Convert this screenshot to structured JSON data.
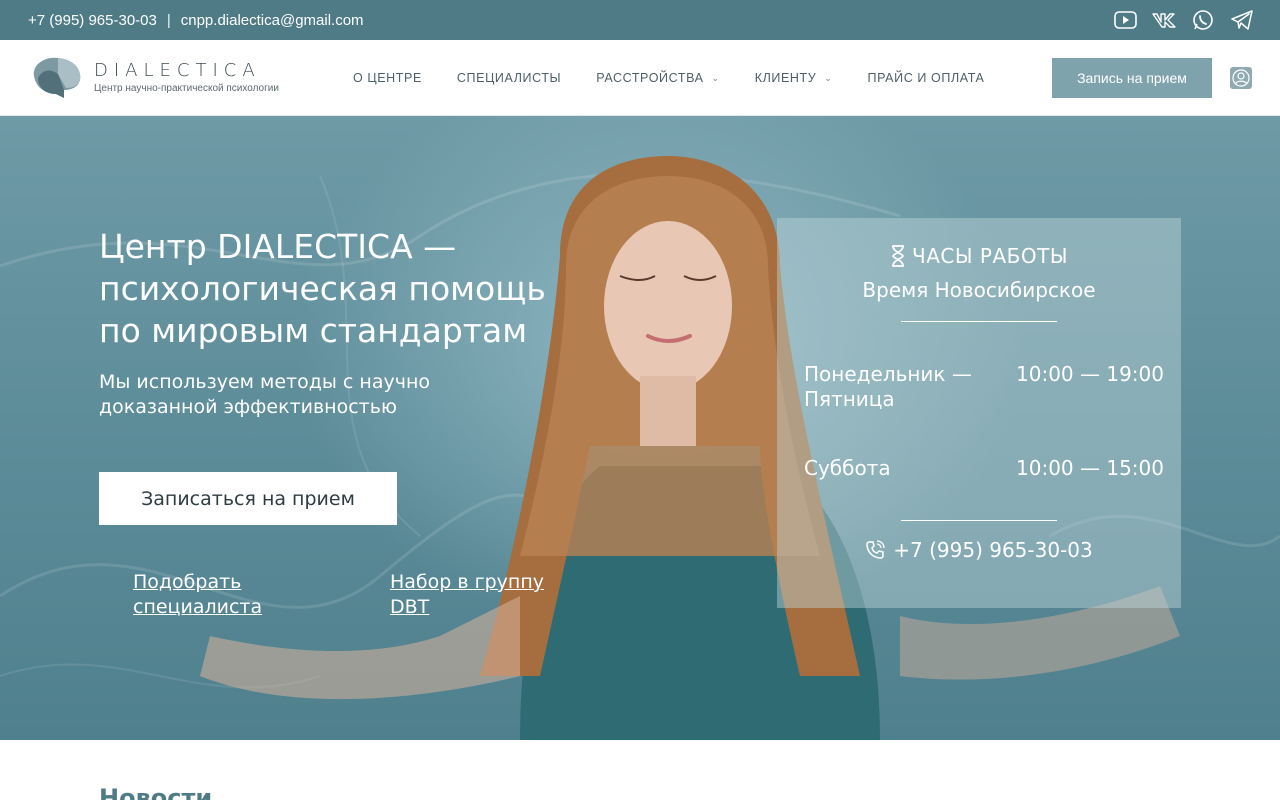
{
  "topbar": {
    "phone": "+7 (995) 965-30-03",
    "separator": "|",
    "email": "cnpp.dialectica@gmail.com",
    "socials": [
      "youtube-icon",
      "vk-icon",
      "whatsapp-icon",
      "telegram-icon"
    ]
  },
  "header": {
    "logo_title": "DIALECTICA",
    "logo_subtitle": "Центр научно-практической психологии",
    "nav": [
      {
        "label": "О ЦЕНТРЕ",
        "dropdown": false
      },
      {
        "label": "СПЕЦИАЛИСТЫ",
        "dropdown": false
      },
      {
        "label": "РАССТРОЙСТВА",
        "dropdown": true
      },
      {
        "label": "КЛИЕНТУ",
        "dropdown": true
      },
      {
        "label": "ПРАЙС И ОПЛАТА",
        "dropdown": false
      }
    ],
    "cta_label": "Запись на прием"
  },
  "hero": {
    "title": "Центр DIALECTICA — психологическая помощь по мировым стандартам",
    "subtitle": "Мы используем методы с научно доказанной эффективностью",
    "button_label": "Записаться на прием",
    "link_specialist": "Подобрать специалиста",
    "link_group": "Набор в группу DBT"
  },
  "hours": {
    "title": "ЧАСЫ РАБОТЫ",
    "timezone": "Время Новосибирское",
    "rows": [
      {
        "day": "Понедельник — Пятница",
        "time": "10:00 — 19:00"
      },
      {
        "day": "Суббота",
        "time": "10:00 — 15:00"
      }
    ],
    "phone": "+7 (995) 965-30-03"
  },
  "news": {
    "heading": "Новости"
  },
  "colors": {
    "topbar": "#4e7b86",
    "accent_button": "#7fa3ac",
    "hero": "#5f8e9b"
  }
}
